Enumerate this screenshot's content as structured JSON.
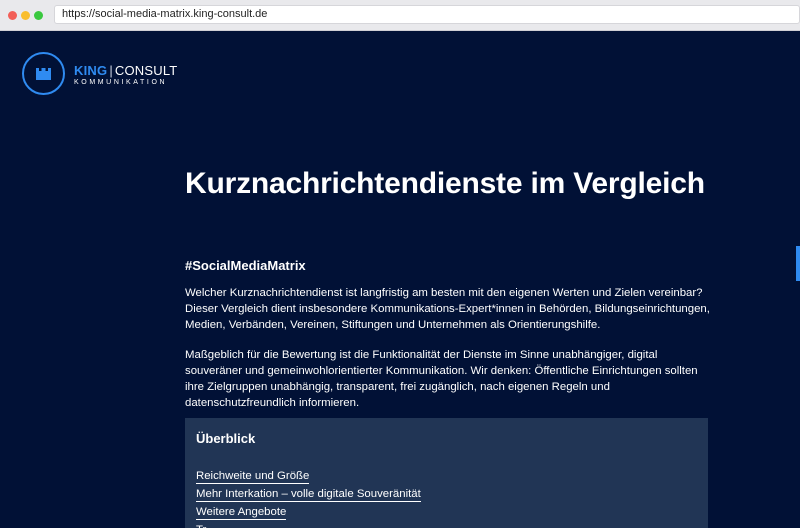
{
  "browser": {
    "url": "https://social-media-matrix.king-consult.de"
  },
  "logo": {
    "brand_primary": "KING",
    "brand_separator": "|",
    "brand_secondary": "CONSULT",
    "brand_sub": "KOMMUNIKATION",
    "icon": "crown-icon",
    "accent_color": "#2f8bf1"
  },
  "main": {
    "title": "Kurznachrichtendienste im Vergleich",
    "hashtag": "#SocialMediaMatrix",
    "paragraph_1": "Welcher Kurznachrichtendienst ist langfristig am besten mit den eigenen Werten und Zielen vereinbar? Dieser Vergleich dient insbesondere Kommunikations-Expert*innen in Behörden, Bildungseinrichtungen, Medien, Verbänden, Vereinen, Stiftungen und Unternehmen als Orientierungshilfe.",
    "paragraph_2": "Maßgeblich für die Bewertung ist die Funktionalität der Dienste im Sinne unabhängiger, digital souveräner und gemeinwohlorientierter Kommunikation. Wir denken: Öffentliche Einrichtungen sollten ihre Zielgruppen unabhängig, transparent, frei zugänglich, nach eigenen Regeln und datenschutzfreundlich informieren."
  },
  "overview": {
    "title": "Überblick",
    "links": [
      {
        "label": "Reichweite und Größe"
      },
      {
        "label": "Mehr Interkation – volle digitale Souveränität"
      },
      {
        "label": "Weitere Angebote"
      },
      {
        "label": "Tr"
      }
    ]
  },
  "colors": {
    "page_background": "#011136",
    "panel_background": "#213555"
  }
}
